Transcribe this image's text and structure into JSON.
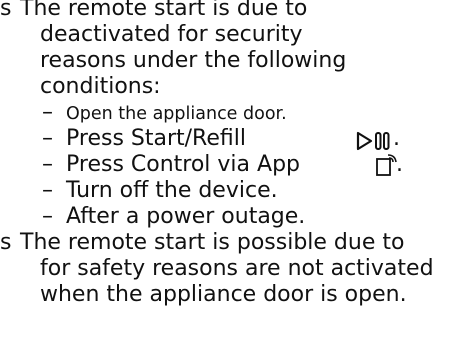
{
  "notes": [
    {
      "bullet": "s",
      "lines": [
        "The remote start is due to",
        "deactivated for security",
        "reasons under the following",
        "conditions:"
      ],
      "items": [
        {
          "dash": "–",
          "text": "Open the appliance door."
        },
        {
          "dash": "–",
          "text": "Press Start/Refill",
          "icon": "start-pause-icon",
          "suffix": "."
        },
        {
          "dash": "–",
          "text": "Press Control via App",
          "icon": "remote-control-icon",
          "suffix": "."
        },
        {
          "dash": "–",
          "text": "Turn off the device."
        },
        {
          "dash": "–",
          "text": "After a power outage."
        }
      ]
    },
    {
      "bullet": "s",
      "lines": [
        "The remote start is possible due to",
        "for safety reasons are not activated",
        "when the appliance door is open."
      ]
    }
  ]
}
